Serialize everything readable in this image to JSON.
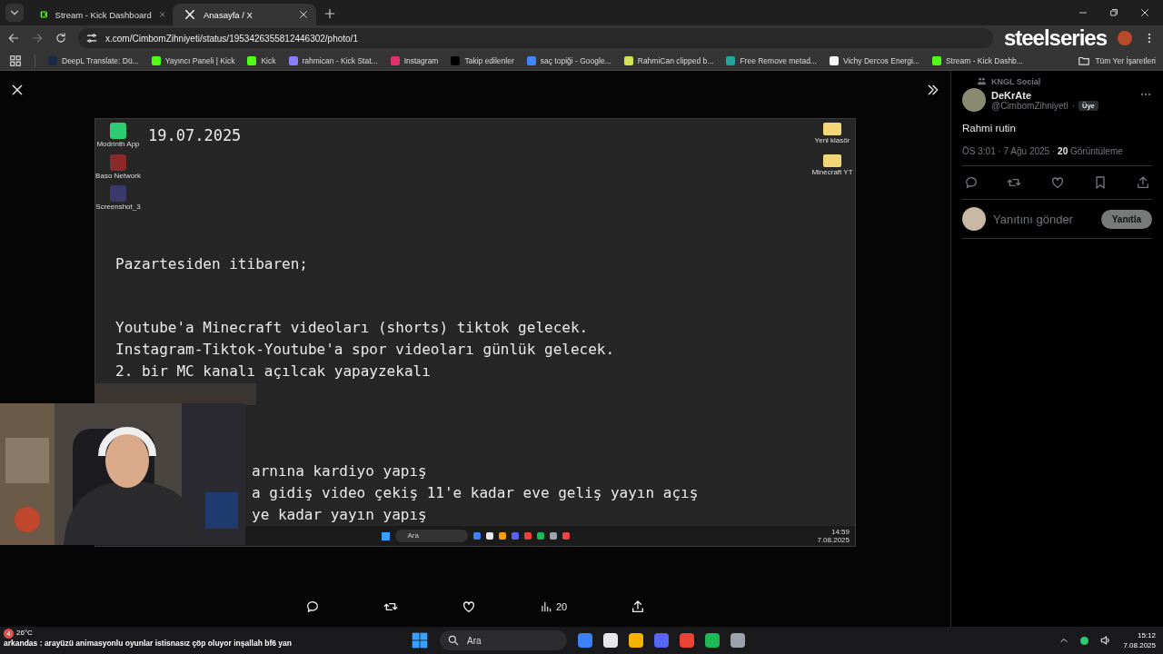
{
  "browser": {
    "tabs": [
      {
        "title": "Stream - Kick Dashboard",
        "kind": "kick",
        "selected": false
      },
      {
        "title": "Anasayfa / X",
        "kind": "x",
        "selected": true
      }
    ],
    "url": "x.com/CimbomZihniyeti/status/1953426355812446302/photo/1",
    "bookmarks": [
      {
        "label": "DeepL Translate: Dü...",
        "color": "#1b2a44"
      },
      {
        "label": "Yayıncı Paneli | Kick",
        "color": "#53fc18"
      },
      {
        "label": "Kick",
        "color": "#53fc18"
      },
      {
        "label": "rahmican - Kick Stat...",
        "color": "#8a7cff"
      },
      {
        "label": "Instagram",
        "color": "#e1306c"
      },
      {
        "label": "Takip edilenler",
        "color": "#000000"
      },
      {
        "label": "saç topiği - Google...",
        "color": "#4285f4"
      },
      {
        "label": "RahmiCan clipped b...",
        "color": "#d4e157"
      },
      {
        "label": "Free Remove metad...",
        "color": "#26a69a"
      },
      {
        "label": "Vichy Dercos Energi...",
        "color": "#f5f5f5"
      },
      {
        "label": "Stream - Kick Dashb...",
        "color": "#53fc18"
      }
    ],
    "all_bookmarks": "Tüm Yer İşaretleri"
  },
  "overlay_logo": "steelseries",
  "viewer": {
    "desktop": {
      "date": "19.07.2025",
      "left_icons": [
        {
          "label": "Modrinth App"
        },
        {
          "label": "Baso Network"
        },
        {
          "label": "Screenshot_3"
        }
      ],
      "right_icons": [
        {
          "label": "Yeni klasör"
        },
        {
          "label": "Minecraft YT"
        }
      ],
      "lines": [
        {
          "text": "Pazartesiden itibaren;",
          "kind": "gap"
        },
        {
          "text": "Youtube'a Minecraft videoları (shorts) tiktok gelecek.",
          "kind": "line"
        },
        {
          "text": "Instagram-Tiktok-Youtube'a spor videoları günlük gelecek.",
          "kind": "line"
        },
        {
          "text": "2. bir MC kanalı açılcak yapayzekalı",
          "kind": "line"
        },
        {
          "text": "arnına kardiyo yapış",
          "kind": "covered"
        },
        {
          "text": "a gidiş video çekiş 11'e kadar eve geliş yayın açış",
          "kind": "covered"
        },
        {
          "text": "ye kadar yayın yapış",
          "kind": "covered"
        }
      ],
      "taskbar": {
        "search": "Ara",
        "time": "14:59",
        "date": "7.08.2025"
      }
    },
    "views": "20"
  },
  "tweet": {
    "community": "KNGL Social",
    "name": "DeKrAte",
    "handle": "@CimbomZihniyeti",
    "separator": "·",
    "badge": "Üye",
    "text": "Rahmi rutin",
    "meta": "ÖS 3:01 · 7 Ağu 2025 · **20** Görüntüleme",
    "reply_placeholder": "Yanıtını gönder",
    "reply_button": {
      "label": "Yanıtla",
      "disabled": true
    }
  },
  "taskbar": {
    "weather_badge": "4",
    "temperature": "26°C",
    "ticker": "arkandas : arayüzü animasyonlu oyunlar istisnasız çöp oluyor inşallah bf6 yan",
    "search": "Ara",
    "time": "15:12",
    "date": "7.08.2025"
  }
}
